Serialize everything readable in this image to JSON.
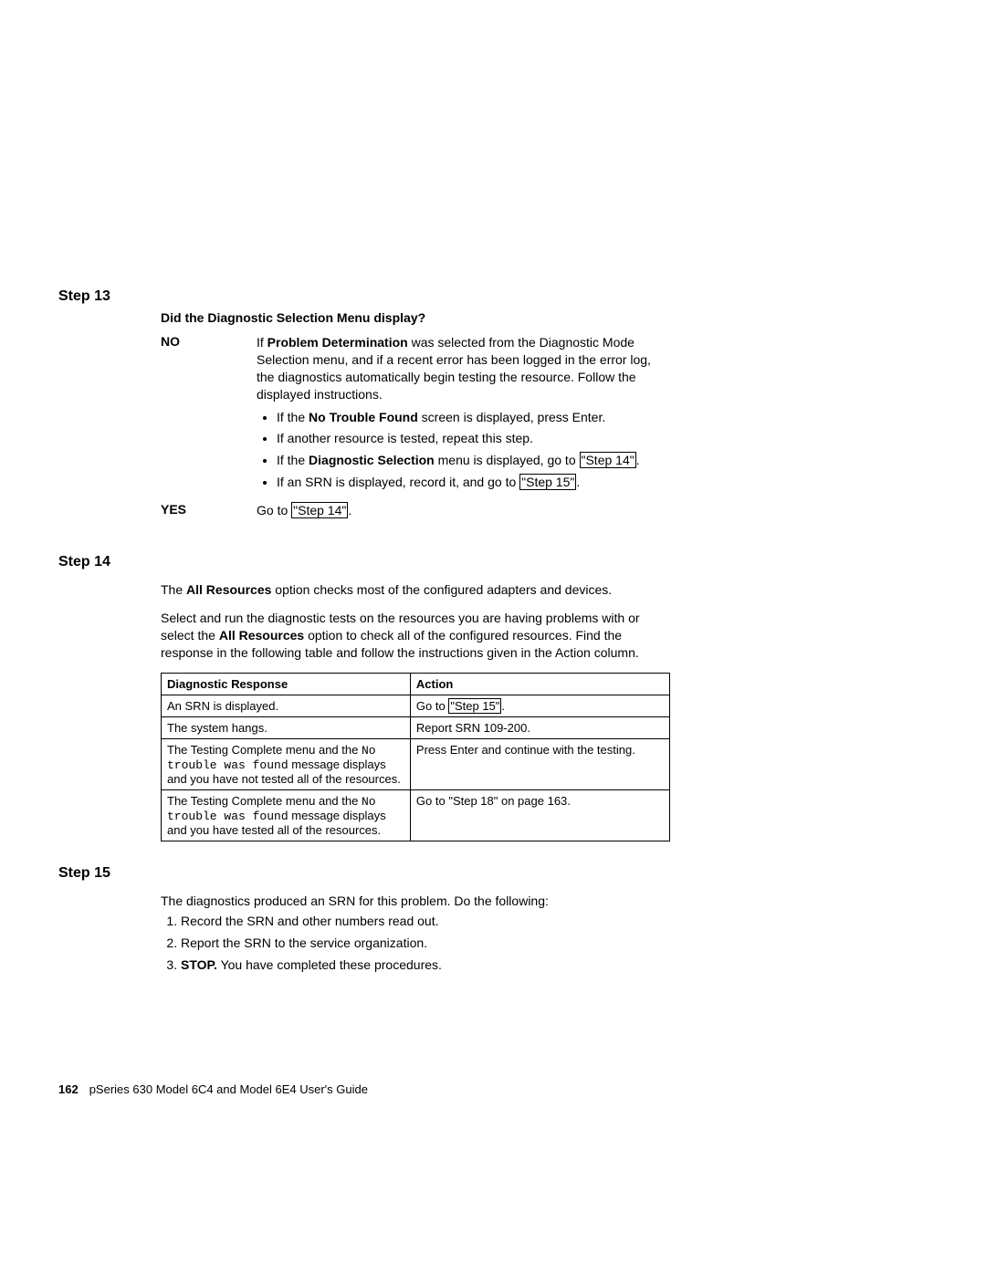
{
  "step13": {
    "heading": "Step 13",
    "question": "Did the Diagnostic Selection Menu display?",
    "no_label": "NO",
    "no_text_1": "If ",
    "no_bold_1": "Problem Determination",
    "no_text_2": " was selected from the Diagnostic Mode Selection menu, and if a recent error has been logged in the error log, the diagnostics automatically begin testing the resource. Follow the displayed instructions.",
    "bullet1_a": "If the ",
    "bullet1_b": "No Trouble Found",
    "bullet1_c": " screen is displayed, press Enter.",
    "bullet2": "If another resource is tested, repeat this step.",
    "bullet3_a": "If the ",
    "bullet3_b": "Diagnostic Selection",
    "bullet3_c": " menu is displayed, go to ",
    "bullet3_link": "\"Step 14\"",
    "bullet3_d": ".",
    "bullet4_a": "If an SRN is displayed, record it, and go to ",
    "bullet4_link": "\"Step 15\"",
    "bullet4_b": ".",
    "yes_label": "YES",
    "yes_text_a": "Go to ",
    "yes_link": "\"Step 14\"",
    "yes_text_b": "."
  },
  "step14": {
    "heading": "Step 14",
    "para1_a": "The ",
    "para1_b": "All Resources",
    "para1_c": " option checks most of the configured adapters and devices.",
    "para2_a": "Select and run the diagnostic tests on the resources you are having problems with or select the ",
    "para2_b": "All Resources",
    "para2_c": " option to check all of the configured resources. Find the response in the following table and follow the instructions given in the Action column.",
    "th1": "Diagnostic Response",
    "th2": "Action",
    "r1c1": "An SRN is displayed.",
    "r1c2_a": "Go to ",
    "r1c2_link": "\"Step 15\"",
    "r1c2_b": ".",
    "r2c1": "The system hangs.",
    "r2c2": "Report SRN 109-200.",
    "r3c1_a": "The Testing Complete menu and the ",
    "r3c1_mono": "No trouble was found",
    "r3c1_b": " message displays and you have not tested all of the resources.",
    "r3c2": "Press Enter and continue with the testing.",
    "r4c1_a": "The Testing Complete menu and the ",
    "r4c1_mono": "No trouble was found",
    "r4c1_b": " message displays and you have tested all of the resources.",
    "r4c2": "Go to \"Step 18\" on page 163."
  },
  "step15": {
    "heading": "Step 15",
    "intro": "The diagnostics produced an SRN for this problem. Do the following:",
    "n1": "Record the SRN and other numbers read out.",
    "n2": "Report the SRN to the service organization.",
    "n3_a": "STOP.",
    "n3_b": " You have completed these procedures."
  },
  "footer": {
    "pagenum": "162",
    "title": "pSeries 630 Model 6C4 and Model 6E4 User's Guide"
  }
}
